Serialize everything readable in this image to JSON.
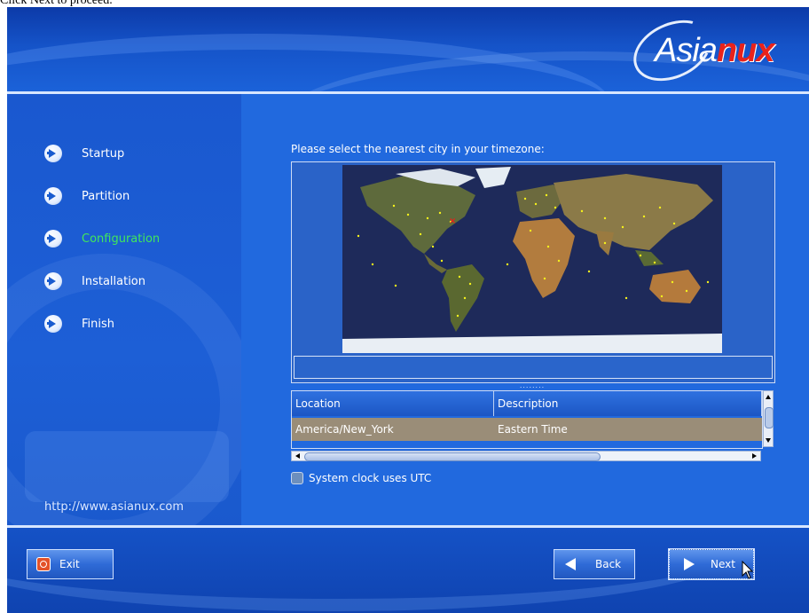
{
  "caption": "Click Next to proceed.",
  "brand": {
    "logo_text_a": "Asia",
    "logo_text_b": "nux"
  },
  "sidebar": {
    "items": [
      {
        "label": "Startup",
        "active": false
      },
      {
        "label": "Partition",
        "active": false
      },
      {
        "label": "Configuration",
        "active": true
      },
      {
        "label": "Installation",
        "active": false
      },
      {
        "label": "Finish",
        "active": false
      }
    ],
    "url": "http://www.asianux.com"
  },
  "main": {
    "prompt": "Please select the nearest city in your timezone:",
    "map": {
      "selected_city_color": "#e8201a",
      "city_dot_color": "#f5f21c"
    },
    "table": {
      "columns": [
        "Location",
        "Description"
      ],
      "rows": [
        {
          "location": "America/New_York",
          "description": "Eastern Time"
        }
      ]
    },
    "utc_checkbox": {
      "label": "System clock uses UTC",
      "checked": false
    }
  },
  "footer": {
    "exit_label": "Exit",
    "back_label": "Back",
    "next_label": "Next"
  },
  "colors": {
    "accent": "#1a5fd0",
    "active_nav": "#41e85a",
    "row_selected": "#9a8d78"
  }
}
